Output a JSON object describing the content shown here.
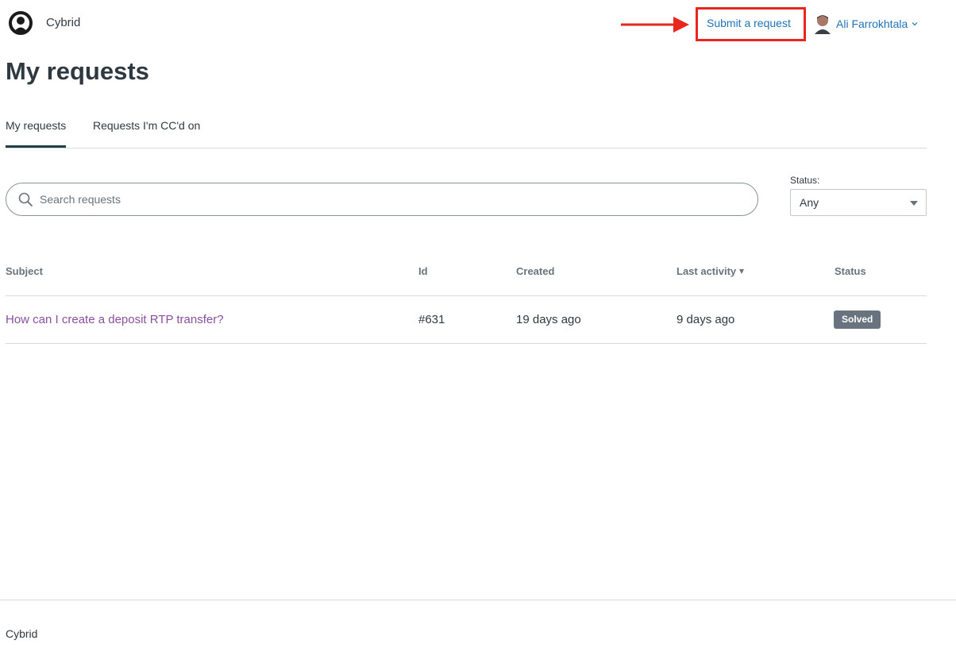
{
  "header": {
    "brand_name": "Cybrid",
    "submit_request_label": "Submit a request",
    "user_name": "Ali Farrokhtala"
  },
  "page": {
    "title": "My requests"
  },
  "tabs": [
    {
      "label": "My requests",
      "active": true
    },
    {
      "label": "Requests I'm CC'd on",
      "active": false
    }
  ],
  "search": {
    "placeholder": "Search requests",
    "value": ""
  },
  "status_filter": {
    "label": "Status:",
    "selected": "Any"
  },
  "table": {
    "columns": [
      "Subject",
      "Id",
      "Created",
      "Last activity",
      "Status"
    ],
    "sorted_by": "Last activity",
    "rows": [
      {
        "subject": "How can I create a deposit RTP transfer?",
        "id": "#631",
        "created": "19 days ago",
        "last_activity": "9 days ago",
        "status": "Solved"
      }
    ]
  },
  "footer": {
    "text": "Cybrid"
  },
  "colors": {
    "link": "#1f73b7",
    "visited_link": "#8a4f9e",
    "annotation_red": "#e8261e",
    "status_badge_bg": "#68737d",
    "tab_indicator": "#1f3d44"
  },
  "icons": {
    "logo": "cybrid-logo-icon",
    "search": "search-icon",
    "user_menu": "chevron-down-icon",
    "status_select": "select-arrow-icon",
    "sort": "sort-desc-icon",
    "annotation": "red-arrow-annotation"
  }
}
